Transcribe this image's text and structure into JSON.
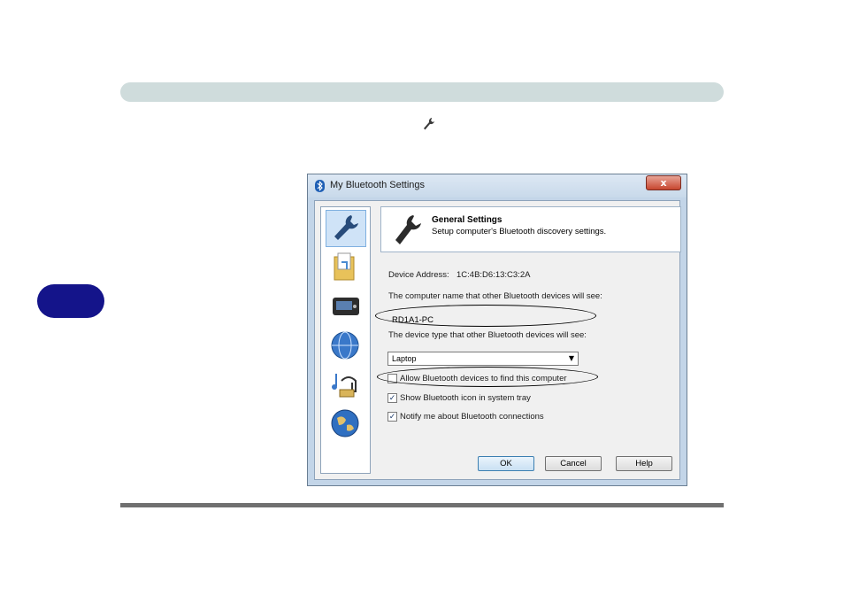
{
  "page": {
    "chapter_tab_color": "#14148a",
    "header_bar_color": "#cfdcdc"
  },
  "inline_icon": "wrench-icon",
  "dialog": {
    "title": "My Bluetooth Settings",
    "close_label": "x",
    "sidebar_items": [
      {
        "icon": "wrench-icon",
        "selected": true
      },
      {
        "icon": "folder-icon",
        "selected": false
      },
      {
        "icon": "device-icon",
        "selected": false
      },
      {
        "icon": "network-globe-icon",
        "selected": false
      },
      {
        "icon": "music-headset-icon",
        "selected": false
      },
      {
        "icon": "globe-icon",
        "selected": false
      }
    ],
    "header": {
      "title": "General Settings",
      "subtitle": "Setup computer's Bluetooth discovery settings."
    },
    "device_address_label": "Device Address:",
    "device_address_value": "1C:4B:D6:13:C3:2A",
    "computer_name_label": "The computer name that other Bluetooth devices will see:",
    "computer_name_value": "RD1A1-PC",
    "device_type_label": "The device type that other Bluetooth devices will see:",
    "device_type_value": "Laptop",
    "checkboxes": [
      {
        "label": "Allow Bluetooth devices to find this computer",
        "checked": false
      },
      {
        "label": "Show Bluetooth icon in system tray",
        "checked": true
      },
      {
        "label": "Notify me about Bluetooth connections",
        "checked": true
      }
    ],
    "buttons": {
      "ok": "OK",
      "cancel": "Cancel",
      "help": "Help"
    }
  }
}
